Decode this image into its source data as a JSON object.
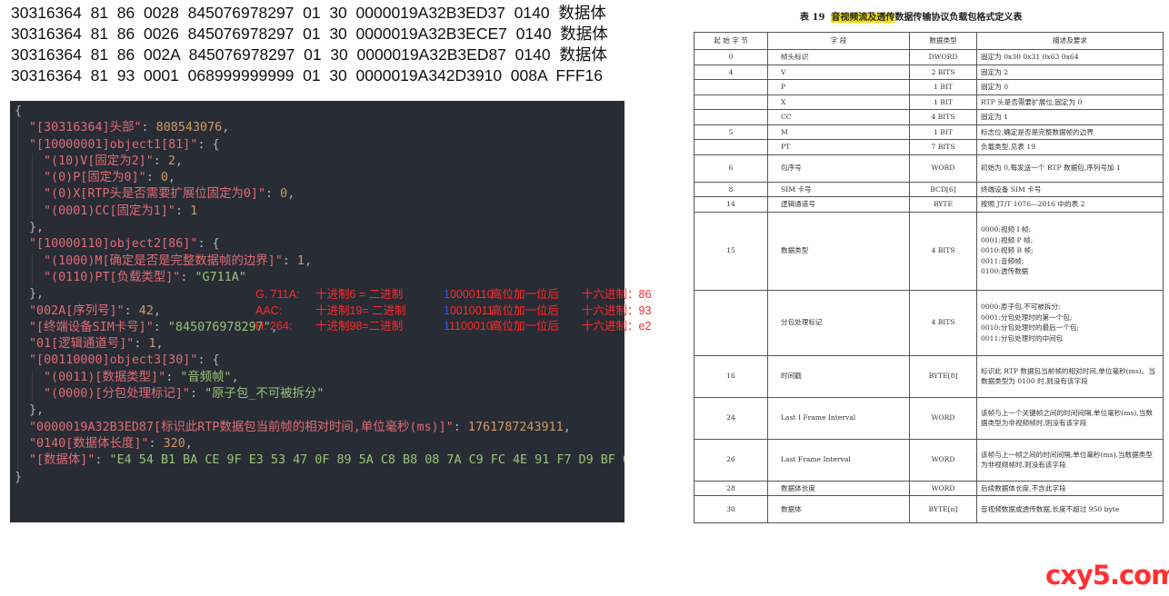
{
  "hex_lines": [
    "30316364  81  86  0028  845076978297  01  30  0000019A32B3ED37  0140  数据体",
    "30316364  81  86  0026  845076978297  01  30  0000019A32B3ECE7  0140  数据体",
    "30316364  81  86  002A  845076978297  01  30  0000019A32B3ED87  0140  数据体",
    "30316364  81  93  0001  068999999999  01  30  0000019A342D3910  008A  FFF16"
  ],
  "code_lines": [
    {
      "indent": 0,
      "parts": [
        {
          "c": "p",
          "t": "{"
        }
      ]
    },
    {
      "indent": 1,
      "parts": [
        {
          "c": "k",
          "t": "\"[30316364]头部\""
        },
        {
          "c": "p",
          "t": ": "
        },
        {
          "c": "n",
          "t": "808543076"
        },
        {
          "c": "p",
          "t": ","
        }
      ]
    },
    {
      "indent": 1,
      "parts": [
        {
          "c": "k",
          "t": "\"[10000001]object1[81]\""
        },
        {
          "c": "p",
          "t": ": {"
        }
      ]
    },
    {
      "indent": 2,
      "parts": [
        {
          "c": "k",
          "t": "\"(10)V[固定为2]\""
        },
        {
          "c": "p",
          "t": ": "
        },
        {
          "c": "n",
          "t": "2"
        },
        {
          "c": "p",
          "t": ","
        }
      ]
    },
    {
      "indent": 2,
      "parts": [
        {
          "c": "k",
          "t": "\"(0)P[固定为0]\""
        },
        {
          "c": "p",
          "t": ": "
        },
        {
          "c": "n",
          "t": "0"
        },
        {
          "c": "p",
          "t": ","
        }
      ]
    },
    {
      "indent": 2,
      "parts": [
        {
          "c": "k",
          "t": "\"(0)X[RTP头是否需要扩展位固定为0]\""
        },
        {
          "c": "p",
          "t": ": "
        },
        {
          "c": "n",
          "t": "0"
        },
        {
          "c": "p",
          "t": ","
        }
      ]
    },
    {
      "indent": 2,
      "parts": [
        {
          "c": "k",
          "t": "\"(0001)CC[固定为1]\""
        },
        {
          "c": "p",
          "t": ": "
        },
        {
          "c": "n",
          "t": "1"
        }
      ]
    },
    {
      "indent": 1,
      "parts": [
        {
          "c": "p",
          "t": "},"
        }
      ]
    },
    {
      "indent": 1,
      "parts": [
        {
          "c": "k",
          "t": "\"[10000110]object2[86]\""
        },
        {
          "c": "p",
          "t": ": {"
        }
      ]
    },
    {
      "indent": 2,
      "parts": [
        {
          "c": "k",
          "t": "\"(1000)M[确定是否是完整数据帧的边界]\""
        },
        {
          "c": "p",
          "t": ": "
        },
        {
          "c": "n",
          "t": "1"
        },
        {
          "c": "p",
          "t": ","
        }
      ]
    },
    {
      "indent": 2,
      "parts": [
        {
          "c": "k",
          "t": "\"(0110)PT[负载类型]\""
        },
        {
          "c": "p",
          "t": ": "
        },
        {
          "c": "s",
          "t": "\"G711A\""
        }
      ]
    },
    {
      "indent": 1,
      "parts": [
        {
          "c": "p",
          "t": "},"
        }
      ]
    },
    {
      "indent": 1,
      "parts": [
        {
          "c": "k",
          "t": "\"002A[序列号]\""
        },
        {
          "c": "p",
          "t": ": "
        },
        {
          "c": "n",
          "t": "42"
        },
        {
          "c": "p",
          "t": ","
        }
      ]
    },
    {
      "indent": 1,
      "parts": [
        {
          "c": "k",
          "t": "\"[终端设备SIM卡号]\""
        },
        {
          "c": "p",
          "t": ": "
        },
        {
          "c": "s",
          "t": "\"845076978297\""
        },
        {
          "c": "p",
          "t": ","
        }
      ]
    },
    {
      "indent": 1,
      "parts": [
        {
          "c": "k",
          "t": "\"01[逻辑通道号]\""
        },
        {
          "c": "p",
          "t": ": "
        },
        {
          "c": "n",
          "t": "1"
        },
        {
          "c": "p",
          "t": ","
        }
      ]
    },
    {
      "indent": 1,
      "parts": [
        {
          "c": "k",
          "t": "\"[00110000]object3[30]\""
        },
        {
          "c": "p",
          "t": ": {"
        }
      ]
    },
    {
      "indent": 2,
      "parts": [
        {
          "c": "k",
          "t": "\"(0011)[数据类型]\""
        },
        {
          "c": "p",
          "t": ": "
        },
        {
          "c": "s",
          "t": "\"音频帧\""
        },
        {
          "c": "p",
          "t": ","
        }
      ]
    },
    {
      "indent": 2,
      "parts": [
        {
          "c": "k",
          "t": "\"(0000)[分包处理标记]\""
        },
        {
          "c": "p",
          "t": ": "
        },
        {
          "c": "s",
          "t": "\"原子包_不可被拆分\""
        }
      ]
    },
    {
      "indent": 1,
      "parts": [
        {
          "c": "p",
          "t": "},"
        }
      ]
    },
    {
      "indent": 1,
      "parts": [
        {
          "c": "k",
          "t": "\"0000019A32B3ED87[标识此RTP数据包当前帧的相对时间,单位毫秒(ms)]\""
        },
        {
          "c": "p",
          "t": ": "
        },
        {
          "c": "n",
          "t": "1761787243911"
        },
        {
          "c": "p",
          "t": ","
        }
      ]
    },
    {
      "indent": 1,
      "parts": [
        {
          "c": "k",
          "t": "\"0140[数据体长度]\""
        },
        {
          "c": "p",
          "t": ": "
        },
        {
          "c": "n",
          "t": "320"
        },
        {
          "c": "p",
          "t": ","
        }
      ]
    },
    {
      "indent": 1,
      "parts": [
        {
          "c": "k",
          "t": "\"[数据体]\""
        },
        {
          "c": "p",
          "t": ": "
        },
        {
          "c": "s",
          "t": "\"E4 54 B1 BA CE 9F E3 53 47 0F 89 5A C8 B8 08 7A C9 FC 4E 91 F7 D9 BF 0"
        }
      ]
    },
    {
      "indent": 0,
      "parts": [
        {
          "c": "p",
          "t": "}"
        }
      ]
    }
  ],
  "annotations": [
    {
      "name": "G. 711A:",
      "dec": "十进制6 = 二进制",
      "b1": "1",
      "bits": "0000110",
      "note": "高位加一位后",
      "hex": "十六进制：86"
    },
    {
      "name": "AAC:",
      "dec": "十进制19= 二进制",
      "b1": "1",
      "bits": "0010011",
      "note": "高位加一位后",
      "hex": "十六进制：93"
    },
    {
      "name": "H. 264:",
      "dec": "十进制98=二进制",
      "b1": "1",
      "bits": "1100010",
      "note": "高位加一位后",
      "hex": "十六进制：e2"
    }
  ],
  "table": {
    "title_prefix": "表 19  ",
    "title_hi": "音视频流及透传",
    "title_rest": "数据传输协议负载包格式定义表",
    "headers": [
      "起 始 字 节",
      "字     段",
      "数据类型",
      "描述及要求"
    ],
    "rows": [
      {
        "h": 14,
        "start": "0",
        "field": "帧头标识",
        "type": "DWORD",
        "desc": "固定为 0x30 0x31 0x63 0x64"
      },
      {
        "h": 14,
        "start": "4",
        "field": "V",
        "type": "2 BITS",
        "desc": "固定为 2"
      },
      {
        "h": 14,
        "start": "",
        "field": "P",
        "type": "1 BIT",
        "desc": "固定为 0"
      },
      {
        "h": 14,
        "start": "",
        "field": "X",
        "type": "1 BIT",
        "desc": "RTP 头是否需要扩展位,固定为 0"
      },
      {
        "h": 14,
        "start": "",
        "field": "CC",
        "type": "4 BITS",
        "desc": "固定为 1"
      },
      {
        "h": 14,
        "start": "5",
        "field": "M",
        "type": "1 BIT",
        "desc": "标志位,确定是否是完整数据帧的边界"
      },
      {
        "h": 14,
        "start": "",
        "field": "PT",
        "type": "7 BITS",
        "desc": "负载类型,见表 19"
      },
      {
        "h": 30,
        "start": "6",
        "field": "包序号",
        "type": "WORD",
        "desc": "初始为 0,每发送一个 RTP 数据包,序列号加 1"
      },
      {
        "h": 14,
        "start": "8",
        "field": "SIM 卡号",
        "type": "BCD[6]",
        "desc": "终端设备 SIM 卡号"
      },
      {
        "h": 14,
        "start": "14",
        "field": "逻辑通道号",
        "type": "BYTE",
        "desc": "按照 JT/T 1076—2016 中的表 2"
      },
      {
        "h": 86,
        "start": "15",
        "field": "数据类型",
        "type": "4 BITS",
        "desc": "0000:视频 I 帧;\n0001:视频 P 帧;\n0010:视频 B 帧;\n0011:音频帧;\n0100:透传数据"
      },
      {
        "h": 72,
        "start": "",
        "field": "分包处理标记",
        "type": "4 BITS",
        "desc": "0000:原子包,不可被拆分;\n0001:分包处理时的第一个包;\n0010:分包处理时的最后一个包;\n0011:分包处理时的中间包"
      },
      {
        "h": 46,
        "start": "16",
        "field": "时间戳",
        "type": "BYTE[8]",
        "desc": "标识此 RTP 数据包当前帧的相对时间,单位毫秒(ms)。当数据类型为 0100 时,则没有该字段"
      },
      {
        "h": 46,
        "start": "24",
        "field": "Last I Frame Interval",
        "type": "WORD",
        "desc": "该帧与上一个关键帧之间的时间间隔,单位毫秒(ms),当数据类型为非视频帧时,则没有该字段"
      },
      {
        "h": 46,
        "start": "26",
        "field": "Last Frame Interval",
        "type": "WORD",
        "desc": "该帧与上一帧之间的时间间隔,单位毫秒(ms),当数据类型为非视频帧时,则没有该字段"
      },
      {
        "h": 14,
        "start": "28",
        "field": "数据体长度",
        "type": "WORD",
        "desc": "后续数据体长度,不含此字段"
      },
      {
        "h": 30,
        "start": "30",
        "field": "数据体",
        "type": "BYTE[n]",
        "desc": "音视频数据或透传数据,长度不超过 950 byte"
      }
    ]
  },
  "watermark": "cxy5.com"
}
